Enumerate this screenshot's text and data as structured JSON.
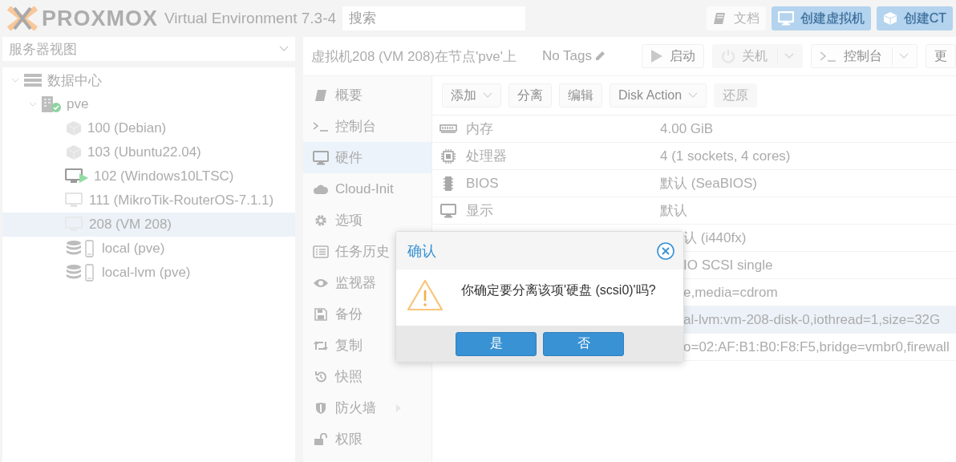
{
  "header": {
    "logo": "PROXMOX",
    "product": "Virtual Environment 7.3-4",
    "search": {
      "placeholder": "搜索"
    },
    "buttons": [
      {
        "label": "文档",
        "kind": "docs"
      },
      {
        "label": "创建虚拟机",
        "kind": "vm"
      },
      {
        "label": "创建CT",
        "kind": "ct"
      }
    ]
  },
  "sidebar": {
    "view": "服务器视图",
    "tree": [
      {
        "label": "数据中心",
        "kind": "datacenter",
        "expanded": true,
        "selected": false,
        "children": [
          {
            "label": "pve",
            "kind": "node",
            "expanded": true,
            "selected": false,
            "children": [
              {
                "label": "100 (Debian)",
                "kind": "ct",
                "selected": false
              },
              {
                "label": "103 (Ubuntu22.04)",
                "kind": "ct",
                "selected": false
              },
              {
                "label": "102 (Windows10LTSC)",
                "kind": "vm-running",
                "selected": false
              },
              {
                "label": "111 (MikroTik-RouterOS-7.1.1)",
                "kind": "vm",
                "selected": false
              },
              {
                "label": "208 (VM 208)",
                "kind": "vm",
                "selected": true
              },
              {
                "label": "local (pve)",
                "kind": "storage",
                "selected": false
              },
              {
                "label": "local-lvm (pve)",
                "kind": "storage",
                "selected": false
              }
            ]
          }
        ]
      }
    ]
  },
  "main": {
    "title": "虚拟机208 (VM 208)在节点'pve'上",
    "tags": "No Tags",
    "actions": [
      {
        "label": "启动",
        "kind": "play",
        "disabled": false,
        "split": false
      },
      {
        "label": "关机",
        "kind": "power",
        "disabled": true,
        "split": true
      },
      {
        "label": "控制台",
        "kind": "terminal",
        "disabled": false,
        "split": true
      },
      {
        "label": "更",
        "kind": "plain",
        "disabled": false,
        "split": false
      }
    ],
    "nav": [
      {
        "label": "概要",
        "kind": "book",
        "selected": false,
        "expandable": false
      },
      {
        "label": "控制台",
        "kind": "terminal",
        "selected": false,
        "expandable": false
      },
      {
        "label": "硬件",
        "kind": "monitor",
        "selected": true,
        "expandable": false
      },
      {
        "label": "Cloud-Init",
        "kind": "cloud",
        "selected": false,
        "expandable": false
      },
      {
        "label": "选项",
        "kind": "gear",
        "selected": false,
        "expandable": false
      },
      {
        "label": "任务历史",
        "kind": "list",
        "selected": false
      },
      {
        "label": "监视器",
        "kind": "eye",
        "selected": false
      },
      {
        "label": "备份",
        "kind": "floppy",
        "selected": false,
        "expandable": false
      },
      {
        "label": "复制",
        "kind": "retweet",
        "selected": false,
        "expandable": false
      },
      {
        "label": "快照",
        "kind": "history",
        "selected": false,
        "expandable": false
      },
      {
        "label": "防火墙",
        "kind": "shield",
        "selected": false,
        "expandable": true
      },
      {
        "label": "权限",
        "kind": "unlock",
        "selected": false,
        "expandable": false
      }
    ],
    "toolbar": [
      {
        "label": "添加",
        "menu": true,
        "disabled": false
      },
      {
        "label": "分离",
        "menu": false,
        "disabled": false
      },
      {
        "label": "编辑",
        "menu": false,
        "disabled": false
      },
      {
        "label": "Disk Action",
        "menu": true,
        "disabled": false
      },
      {
        "label": "还原",
        "menu": false,
        "disabled": true
      }
    ],
    "hardware": [
      {
        "kind": "memory",
        "label": "内存",
        "value": "4.00 GiB",
        "selected": false
      },
      {
        "kind": "cpu",
        "label": "处理器",
        "value": "4 (1 sockets, 4 cores)",
        "selected": false
      },
      {
        "kind": "chip",
        "label": "BIOS",
        "value": "默认 (SeaBIOS)",
        "selected": false
      },
      {
        "kind": "monitor",
        "label": "显示",
        "value": "默认",
        "selected": false
      },
      {
        "kind": "covered",
        "value": "认 (i440fx)",
        "selected": false
      },
      {
        "kind": "covered",
        "value": "IO SCSI single",
        "selected": false
      },
      {
        "kind": "covered",
        "value": "e,media=cdrom",
        "selected": false
      },
      {
        "kind": "covered",
        "value": "al-lvm:vm-208-disk-0,iothread=1,size=32G",
        "selected": true
      },
      {
        "kind": "covered",
        "value": "o=02:AF:B1:B0:F8:F5,bridge=vmbr0,firewall",
        "selected": false
      }
    ]
  },
  "dialog": {
    "title": "确认",
    "message": "你确定要分离该项'硬盘 (scsi0)'吗?",
    "buttons": [
      "是",
      "否"
    ]
  }
}
